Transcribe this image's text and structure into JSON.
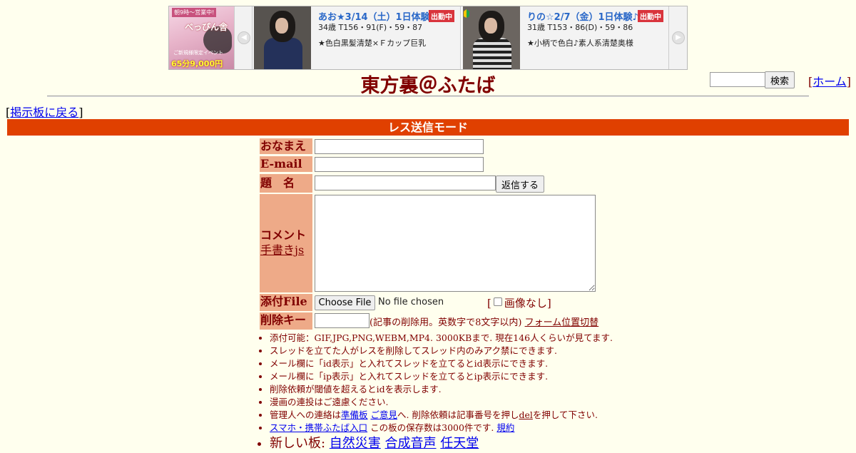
{
  "ad": {
    "shop": {
      "tag": "朝9時～営業中!",
      "logo": "べっぴん舎",
      "sub": "ご新規様限定イベント",
      "price": "65分9,000円～!"
    },
    "prev_arrow": "◀",
    "next_arrow": "▶",
    "cards": [
      {
        "title": "あお★3/14（土）1日体験♪",
        "badge": "出勤中",
        "spec": "34歳 T156・91(F)・59・87",
        "desc": "★色白黒髪清楚×Ｆカップ巨乳"
      },
      {
        "title": "りの☆2/7（金）1日体験♪",
        "badge": "出勤中",
        "spec": "31歳 T153・86(D)・59・86",
        "desc": "★小柄で色白♪素人系清楚奥様"
      }
    ]
  },
  "header": {
    "board_title": "東方裏＠ふたば",
    "search_button": "検索",
    "home_open": "[",
    "home_link": "ホーム",
    "home_close": "]",
    "back_open": "[",
    "back_link": "掲示板に戻る",
    "back_close": "]"
  },
  "mode_banner": "レス送信モード",
  "form": {
    "name_label": "おなまえ",
    "email_label": "E-mail",
    "subject_label": "題　名",
    "submit_button": "返信する",
    "comment_label": "コメント",
    "handwrite_link": "手書きjs",
    "file_label": "添付File",
    "choose_file": "Choose File",
    "no_file": "No file chosen",
    "noimg_open": "[",
    "noimg_label": "画像なし",
    "noimg_close": "]",
    "delkey_label": "削除キー",
    "delkey_note": "(記事の削除用。英数字で8文字以内)",
    "form_toggle_link": "フォーム位置切替"
  },
  "rules": [
    "添付可能：GIF,JPG,PNG,WEBM,MP4. 3000KBまで. 現在146人くらいが見てます.",
    "スレッドを立てた人がレスを削除してスレッド内のみアク禁にできます.",
    "メール欄に「id表示」と入れてスレッドを立てるとid表示にできます.",
    "メール欄に「ip表示」と入れてスレッドを立てるとip表示にできます.",
    "削除依頼が閾値を超えるとidを表示します.",
    "漫画の連投はご遠慮ください."
  ],
  "rule_admin": {
    "before": "管理人への連絡は",
    "link1": "準備板",
    "link2": "ご意見",
    "middle": "へ. 削除依頼は記事番号を押し",
    "del": "del",
    "after": "を押して下さい."
  },
  "rule_mobile": {
    "link": "スマホ・携帯ふたば入口",
    "text": " この板の保存数は3000件です. ",
    "rules_link": "規約"
  },
  "rule_new_boards": {
    "label": "新しい板: ",
    "boards": [
      "自然災害",
      "合成音声",
      "任天堂"
    ]
  }
}
